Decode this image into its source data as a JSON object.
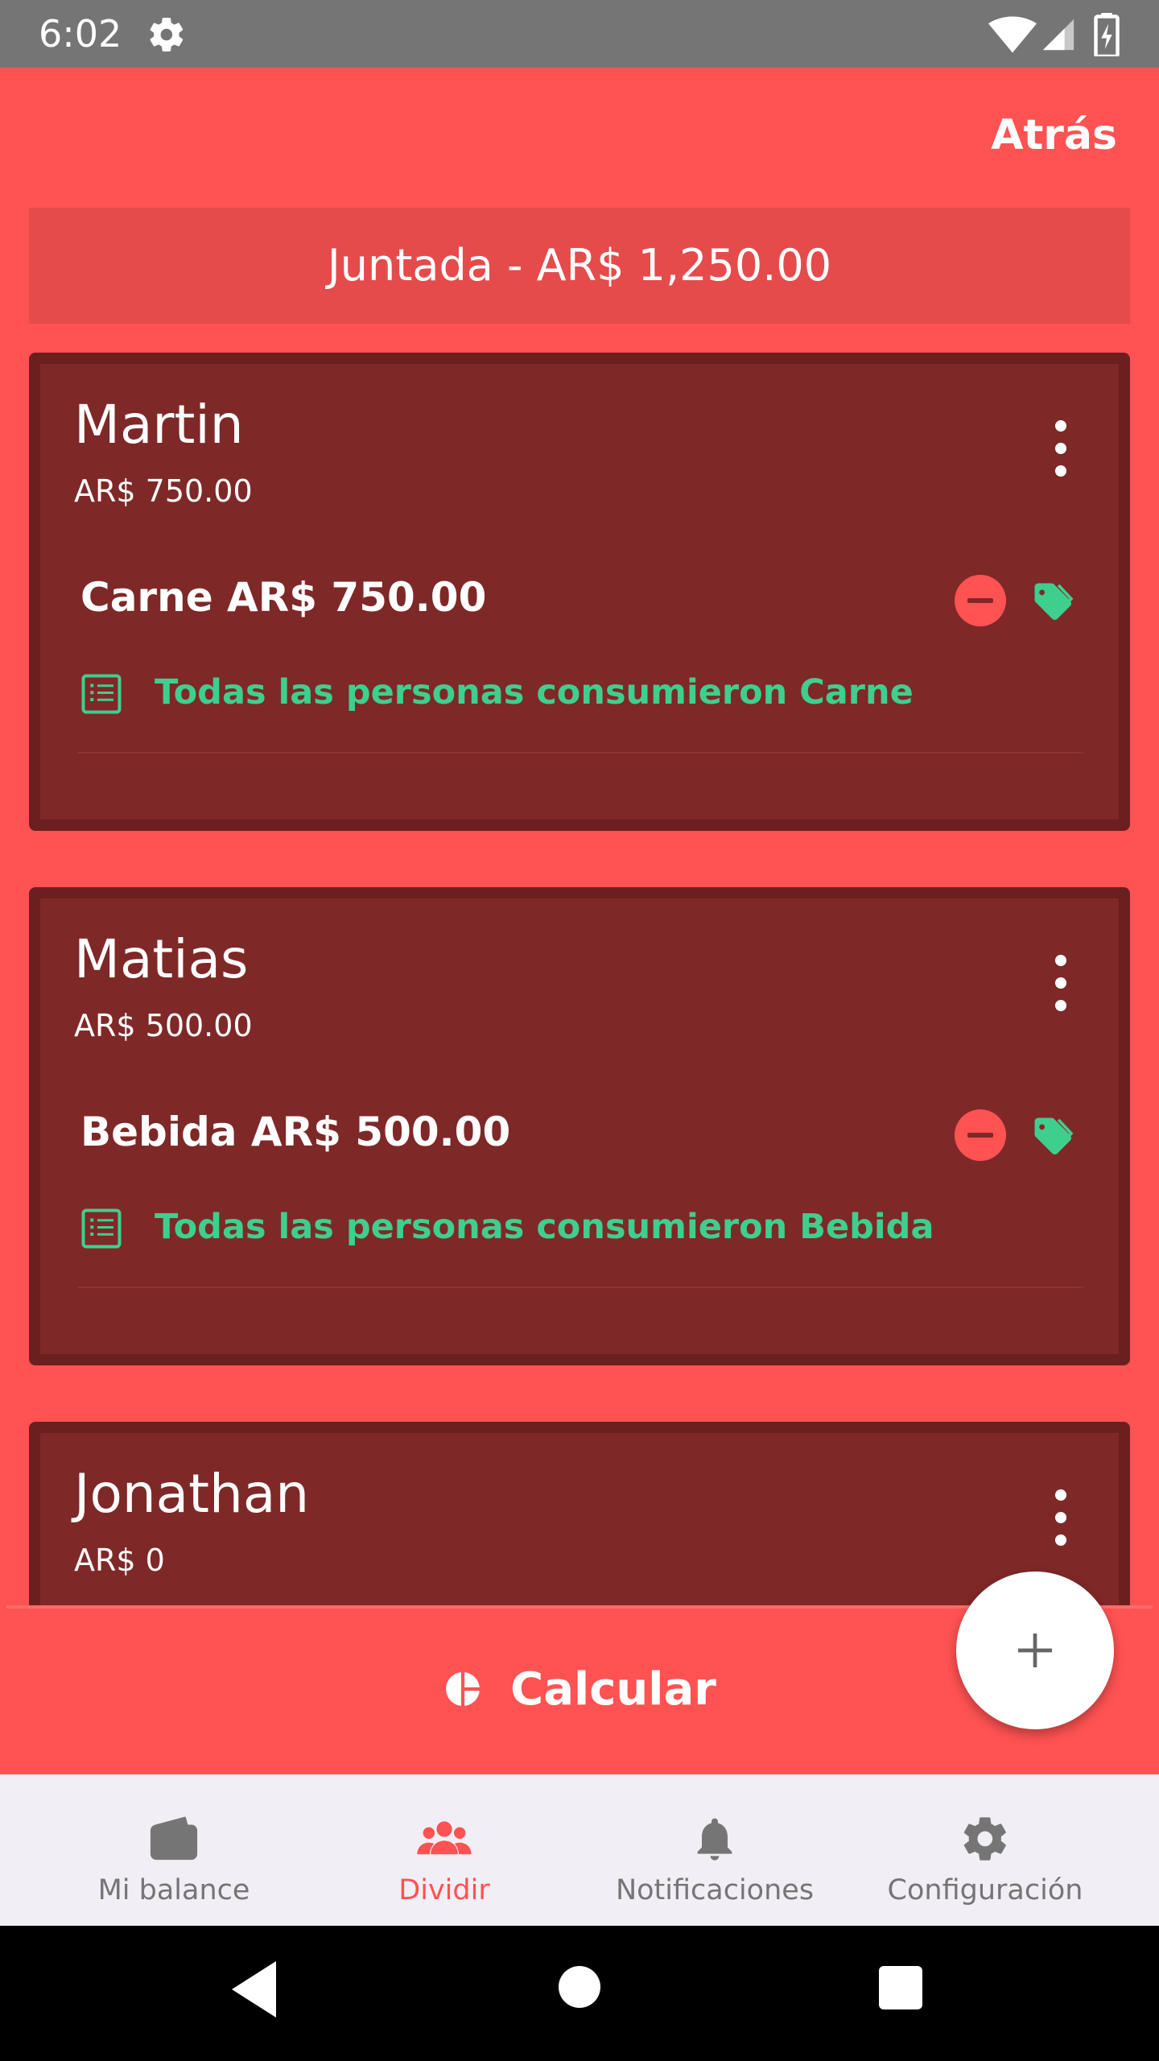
{
  "status_bar": {
    "time": "6:02"
  },
  "header": {
    "back_label": "Atrás"
  },
  "banner": {
    "title": "Juntada - AR$ 1,250.00"
  },
  "people": [
    {
      "name": "Martin",
      "total": "AR$ 750.00",
      "item_name": "Carne",
      "item_amount": "AR$ 750.00",
      "consumers_text": "Todas las personas consumieron Carne"
    },
    {
      "name": "Matias",
      "total": "AR$ 500.00",
      "item_name": "Bebida",
      "item_amount": "AR$ 500.00",
      "consumers_text": "Todas las personas consumieron Bebida"
    },
    {
      "name": "Jonathan",
      "total": "AR$ 0"
    }
  ],
  "calculate": {
    "label": "Calcular"
  },
  "bottom_nav": {
    "items": [
      {
        "label": "Mi balance",
        "icon": "wallet-icon"
      },
      {
        "label": "Dividir",
        "icon": "group-icon",
        "active": true
      },
      {
        "label": "Notificaciones",
        "icon": "bell-icon"
      },
      {
        "label": "Configuración",
        "icon": "gear-icon"
      }
    ]
  },
  "colors": {
    "accent": "#ff5252",
    "card": "#7f2828",
    "green": "#3ecf8e",
    "nav_bg": "#f1eff5"
  }
}
